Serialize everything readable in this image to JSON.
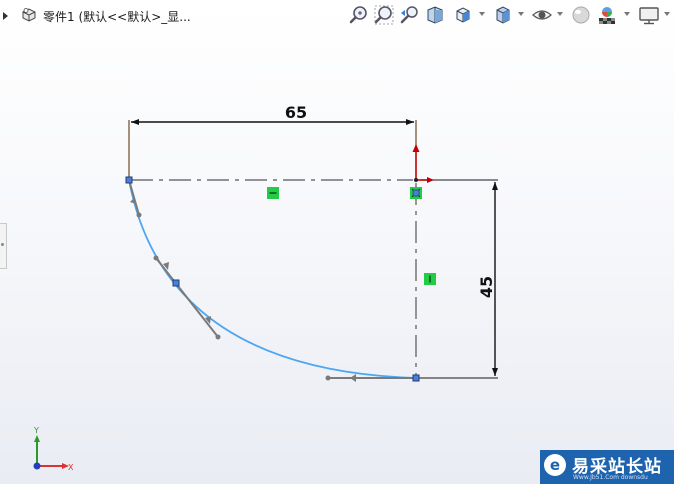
{
  "header": {
    "document_title": "零件1  (默认<<默认>_显..."
  },
  "toolbar": {
    "icons": [
      "zoom-to-fit-icon",
      "zoom-to-area-icon",
      "previous-view-icon",
      "section-view-icon",
      "view-orientation-icon",
      "display-style-icon",
      "hide-show-items-icon",
      "edit-appearance-icon",
      "apply-scene-icon",
      "view-settings-icon"
    ]
  },
  "sketch": {
    "dimensions": {
      "horizontal": "65",
      "vertical": "45"
    },
    "colors": {
      "arc": "#4da6f2",
      "construction_line": "#555555",
      "relation_badge": "#22cc44",
      "origin_y_arrow": "#c00000",
      "endpoint": "#4a7fd6"
    }
  },
  "triad": {
    "x_label": "X",
    "y_label": "Y",
    "colors": {
      "x": "#e03030",
      "y": "#2a9a2a",
      "z": "#2040c0"
    }
  },
  "watermark": {
    "logo_char": "e",
    "name": "易采站长站",
    "url": "Www.Jb51.Com  downsdu"
  }
}
